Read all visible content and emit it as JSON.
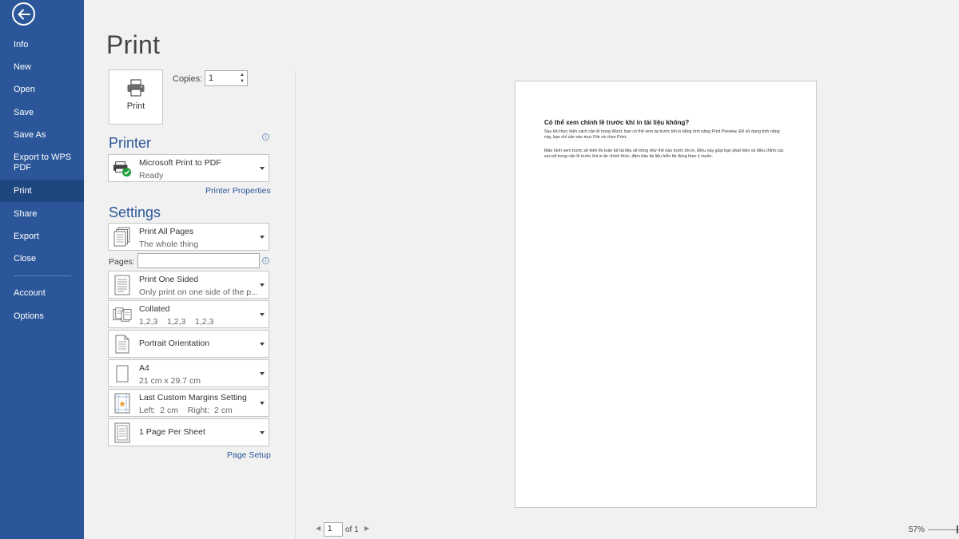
{
  "sidebar": {
    "items": [
      {
        "id": "info",
        "label": "Info"
      },
      {
        "id": "new",
        "label": "New"
      },
      {
        "id": "open",
        "label": "Open"
      },
      {
        "id": "save",
        "label": "Save"
      },
      {
        "id": "save-as",
        "label": "Save As"
      },
      {
        "id": "export-wps",
        "label": "Export to WPS PDF"
      },
      {
        "id": "print",
        "label": "Print",
        "active": true
      },
      {
        "id": "share",
        "label": "Share"
      },
      {
        "id": "export",
        "label": "Export"
      },
      {
        "id": "close",
        "label": "Close"
      },
      {
        "id": "account",
        "label": "Account"
      },
      {
        "id": "options",
        "label": "Options"
      }
    ]
  },
  "main": {
    "title": "Print",
    "print_button_label": "Print",
    "copies_label": "Copies:",
    "copies_value": "1",
    "printer_heading": "Printer",
    "printer": {
      "name": "Microsoft Print to PDF",
      "status": "Ready",
      "icon": "printer-ready-icon"
    },
    "printer_properties_link": "Printer Properties",
    "settings_heading": "Settings",
    "settings": [
      {
        "id": "print-range",
        "line1": "Print All Pages",
        "line2": "The whole thing",
        "icon": "pages-icon"
      },
      {
        "id": "sides",
        "line1": "Print One Sided",
        "line2": "Only print on one side of the p...",
        "icon": "one-sided-icon"
      },
      {
        "id": "collation",
        "line1": "Collated",
        "line2": "1,2,3    1,2,3    1,2,3",
        "icon": "collated-icon"
      },
      {
        "id": "orientation",
        "line1": "Portrait Orientation",
        "line2": "",
        "icon": "portrait-icon"
      },
      {
        "id": "paper-size",
        "line1": "A4",
        "line2": "21 cm x 29.7 cm",
        "icon": "paper-size-icon"
      },
      {
        "id": "margins",
        "line1": "Last Custom Margins Setting",
        "line2": "Left:  2 cm    Right:  2 cm",
        "icon": "margins-icon"
      },
      {
        "id": "pages-per-sheet",
        "line1": "1 Page Per Sheet",
        "line2": "",
        "icon": "pages-per-sheet-icon"
      }
    ],
    "pages_label": "Pages:",
    "pages_value": "",
    "page_setup_link": "Page Setup"
  },
  "preview": {
    "heading": "Có thể xem chỉnh lề trước khi in tài liệu không?",
    "paragraph1": "Sau khi thực hiện cách căn lề trong Word, bạn có thể xem lại trước khi in bằng tính năng Print Preview. Để sử dụng tính năng này, bạn chỉ cần vào mục File và chọn Print.",
    "paragraph2": "Màn hình xem trước sẽ hiển thị toàn bộ tài liệu sẽ trông như thế nào trước khi in. Điều này giúp bạn phát hiện và điều chỉnh các sai sót trong căn lề trước khi in ấn chính thức, đảm bảo tài liệu hiển thị đúng theo ý muốn.",
    "current_page": "1",
    "of_total": "of 1",
    "zoom": "57%"
  },
  "colors": {
    "accent": "#2b579a",
    "sidebar_active": "#1f477f",
    "background": "#f1f1f1"
  }
}
